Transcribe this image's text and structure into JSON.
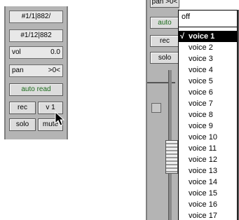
{
  "left_strip": {
    "input_label": "#1/1|882/",
    "output_label": "#1/12|882",
    "vol_label": "vol",
    "vol_value": "0.0",
    "pan_label": "pan",
    "pan_value": ">0<",
    "automation_mode": "auto read",
    "rec_label": "rec",
    "voice_label": "v 1",
    "solo_label": "solo",
    "mute_label": "mute"
  },
  "right_strip": {
    "pan_label": "pan",
    "pan_value": ">0<",
    "auto_label": "auto",
    "rec_label": "rec",
    "solo_label": "solo"
  },
  "voice_menu": {
    "off_label": "off",
    "check_mark": "√",
    "selected": "voice 1",
    "items": [
      "voice 2",
      "voice 3",
      "voice 4",
      "voice 5",
      "voice 6",
      "voice 7",
      "voice 8",
      "voice 9",
      "voice 10",
      "voice 11",
      "voice 12",
      "voice 13",
      "voice 14",
      "voice 15",
      "voice 16",
      "voice 17"
    ]
  }
}
